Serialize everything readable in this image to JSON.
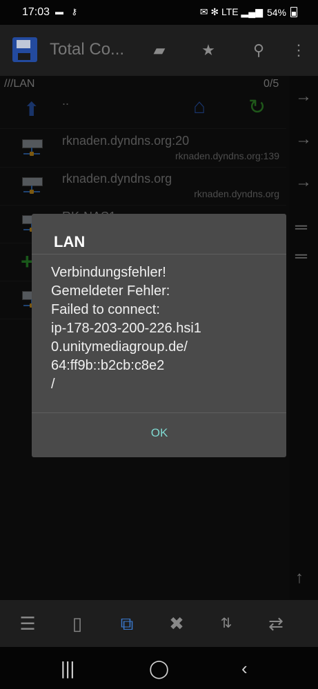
{
  "status": {
    "time": "17:03",
    "notif_icons": "▬ ⚷",
    "sys_icons": "✉ ✻ LTE ▂▄▆",
    "battery": "54%"
  },
  "appbar": {
    "title": "Total Co..."
  },
  "panel": {
    "path": "///LAN",
    "count": "0/5",
    "up_label": "..",
    "rows": [
      {
        "name": "rknaden.dyndns.org:20",
        "sub": "rknaden.dyndns.org:139"
      },
      {
        "name": "rknaden.dyndns.org",
        "sub": "rknaden.dyndns.org"
      },
      {
        "name": "RK-NAS1",
        "sub": ""
      }
    ]
  },
  "dialog": {
    "title": "LAN",
    "lines": [
      "Verbindungsfehler!",
      "Gemeldeter Fehler:",
      "Failed to connect:",
      "ip-178-203-200-226.hsi1",
      "0.unitymediagroup.de/",
      "64:ff9b::b2cb:c8e2",
      "/"
    ],
    "ok_label": "OK"
  }
}
